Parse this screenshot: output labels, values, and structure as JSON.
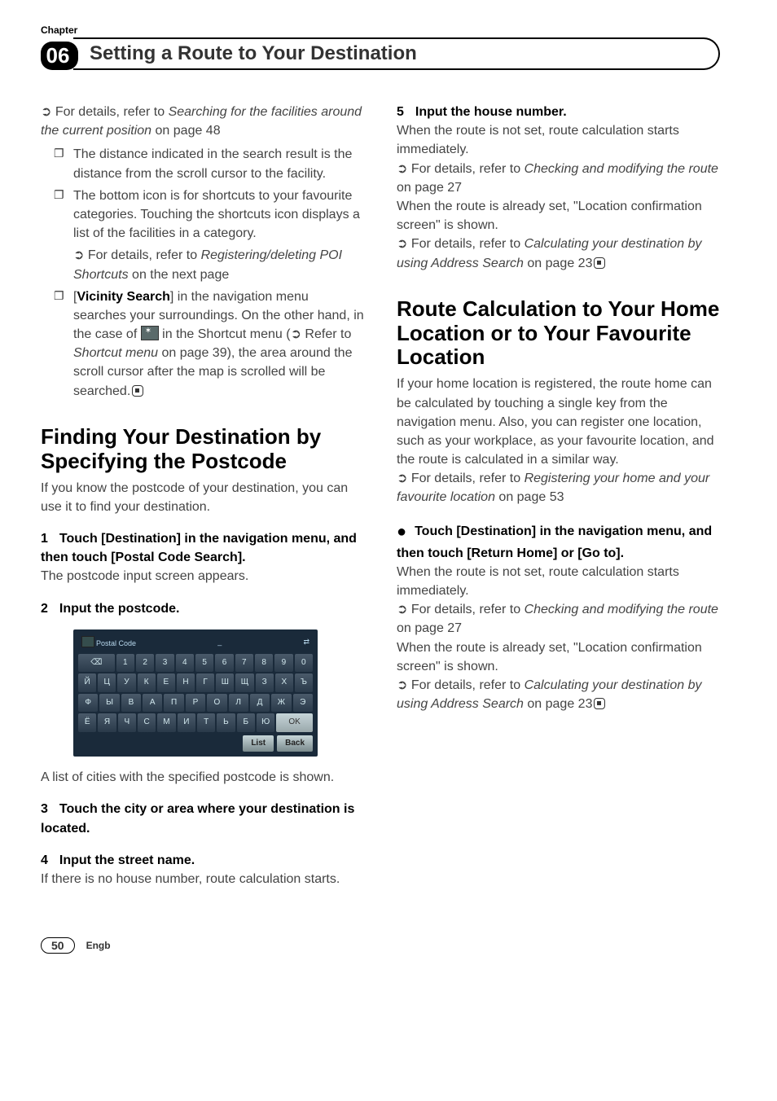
{
  "header": {
    "chapter_label": "Chapter",
    "chapter_number": "06",
    "title": "Setting a Route to Your Destination"
  },
  "left": {
    "ref1_prefix": "➲ For details, refer to ",
    "ref1_italic": "Searching for the facilities around the current position",
    "ref1_suffix": " on page 48",
    "bullets": [
      {
        "text": "The distance indicated in the search result is the distance from the scroll cursor to the facility."
      },
      {
        "text": "The bottom icon is for shortcuts to your favourite categories. Touching the shortcuts icon displays a list of the facilities in a category.",
        "subref_prefix": "➲ For details, refer to ",
        "subref_italic": "Registering/deleting POI Shortcuts",
        "subref_suffix": " on the next page"
      },
      {
        "lead_open": "[",
        "lead_bold": "Vicinity Search",
        "lead_close": "] in the navigation menu searches your surroundings. On the other hand, in the case of ",
        "mid_after_icon": " in the Shortcut menu (➲ Refer to ",
        "mid_italic": "Shortcut menu",
        "mid_after": " on page 39), the area around the scroll cursor after the map is scrolled will be searched."
      }
    ],
    "section_title": "Finding Your Destination by Specifying the Postcode",
    "section_intro": "If you know the postcode of your destination, you can use it to find your destination.",
    "step1_num": "1",
    "step1_text": "Touch [Destination] in the navigation menu, and then touch [Postal Code Search].",
    "step1_after": "The postcode input screen appears.",
    "step2_num": "2",
    "step2_text": "Input the postcode.",
    "keyboard": {
      "title": "Postal Code",
      "field": "_",
      "row1": [
        "⌫",
        "1",
        "2",
        "3",
        "4",
        "5",
        "6",
        "7",
        "8",
        "9",
        "0"
      ],
      "row2": [
        "Й",
        "Ц",
        "У",
        "К",
        "Е",
        "Н",
        "Г",
        "Ш",
        "Щ",
        "З",
        "Х",
        "Ъ"
      ],
      "row3": [
        "Ф",
        "Ы",
        "В",
        "А",
        "П",
        "Р",
        "О",
        "Л",
        "Д",
        "Ж",
        "Э"
      ],
      "row4": [
        "Ё",
        "Я",
        "Ч",
        "С",
        "М",
        "И",
        "Т",
        "Ь",
        "Б",
        "Ю",
        "OK"
      ],
      "list_btn": "List",
      "back_btn": "Back"
    },
    "after_kb": "A list of cities with the specified postcode is shown.",
    "step3_num": "3",
    "step3_text": "Touch the city or area where your destination is located.",
    "step4_num": "4",
    "step4_text": "Input the street name.",
    "step4_after": "If there is no house number, route calculation starts."
  },
  "right": {
    "step5_num": "5",
    "step5_text": "Input the house number.",
    "p1": "When the route is not set, route calculation starts immediately.",
    "ref2_prefix": "➲ For details, refer to ",
    "ref2_italic": "Checking and modifying the route",
    "ref2_suffix": " on page 27",
    "p2": "When the route is already set, \"Location confirmation screen\" is shown.",
    "ref3_prefix": "➲ For details, refer to ",
    "ref3_italic": "Calculating your destination by using Address Search",
    "ref3_suffix": " on page 23",
    "section_title": "Route Calculation to Your Home Location or to Your Favourite Location",
    "section_intro": "If your home location is registered, the route home can be calculated by touching a single key from the navigation menu. Also, you can register one location, such as your workplace, as your favourite location, and the route is calculated in a similar way.",
    "ref4_prefix": "➲ For details, refer to ",
    "ref4_italic": "Registering your home and your favourite location",
    "ref4_suffix": " on page 53",
    "bullet_step": "Touch [Destination] in the navigation menu, and then touch [Return Home] or [Go to].",
    "p3": "When the route is not set, route calculation starts immediately.",
    "ref5_prefix": "➲ For details, refer to ",
    "ref5_italic": "Checking and modifying the route",
    "ref5_suffix": " on page 27",
    "p4": "When the route is already set, \"Location confirmation screen\" is shown.",
    "ref6_prefix": "➲ For details, refer to ",
    "ref6_italic": "Calculating your destination by using Address Search",
    "ref6_suffix": " on page 23"
  },
  "footer": {
    "page": "50",
    "lang": "Engb"
  }
}
